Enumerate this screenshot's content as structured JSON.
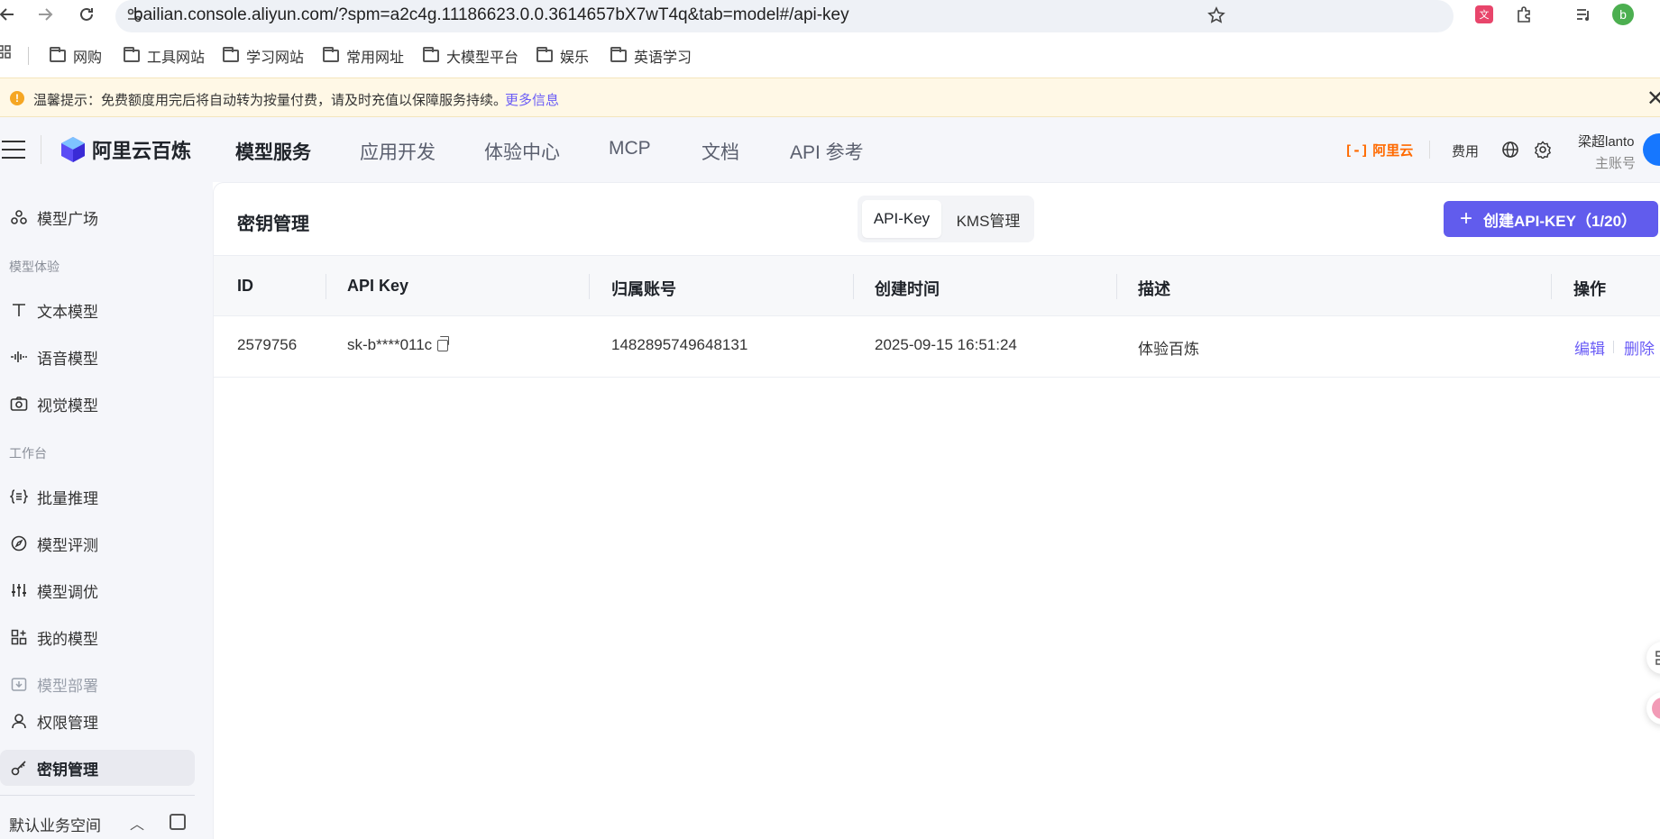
{
  "browser": {
    "url": "bailian.console.aliyun.com/?spm=a2c4g.11186623.0.0.3614657bX7wT4q&tab=model#/api-key",
    "profile_initial": "b"
  },
  "bookmarks": [
    "网购",
    "工具网站",
    "学习网站",
    "常用网址",
    "大模型平台",
    "娱乐",
    "英语学习"
  ],
  "notice": {
    "text": "温馨提示：免费额度用完后将自动转为按量付费，请及时充值以保障服务持续。",
    "link": "更多信息"
  },
  "header": {
    "logo": "阿里云百炼",
    "nav": [
      "模型服务",
      "应用开发",
      "体验中心",
      "MCP",
      "文档",
      "API 参考"
    ],
    "brand": "阿里云",
    "fee": "费用",
    "user_name": "梁超lanto",
    "user_role": "主账号"
  },
  "sidebar": {
    "plaza": "模型广场",
    "section_experience": "模型体验",
    "text_model": "文本模型",
    "voice_model": "语音模型",
    "vision_model": "视觉模型",
    "section_workbench": "工作台",
    "batch": "批量推理",
    "evaluate": "模型评测",
    "tune": "模型调优",
    "my_models": "我的模型",
    "deploy": "模型部署",
    "permissions": "权限管理",
    "keys": "密钥管理",
    "workspace": "默认业务空间"
  },
  "main": {
    "title": "密钥管理",
    "tabs": [
      "API-Key",
      "KMS管理"
    ],
    "create_button": "创建API-KEY（1/20）",
    "columns": [
      "ID",
      "API Key",
      "归属账号",
      "创建时间",
      "描述",
      "操作"
    ],
    "rows": [
      {
        "id": "2579756",
        "api_key": "sk-b****011c",
        "account": "1482895749648131",
        "created": "2025-09-15 16:51:24",
        "description": "体验百炼",
        "edit": "编辑",
        "delete": "删除"
      }
    ]
  },
  "colors": {
    "accent": "#615ced",
    "link": "#6a5cf6",
    "brand_orange": "#ff6a00"
  }
}
